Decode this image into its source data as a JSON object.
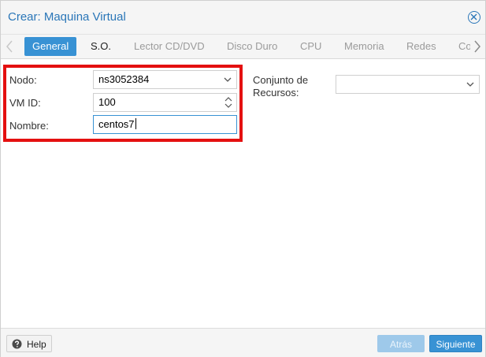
{
  "window": {
    "title": "Crear: Maquina Virtual"
  },
  "tabs": [
    {
      "label": "General",
      "state": "active"
    },
    {
      "label": "S.O.",
      "state": "enabled"
    },
    {
      "label": "Lector CD/DVD",
      "state": "disabled"
    },
    {
      "label": "Disco Duro",
      "state": "disabled"
    },
    {
      "label": "CPU",
      "state": "disabled"
    },
    {
      "label": "Memoria",
      "state": "disabled"
    },
    {
      "label": "Redes",
      "state": "disabled"
    },
    {
      "label": "Co",
      "state": "disabled"
    }
  ],
  "form": {
    "node_label": "Nodo:",
    "node_value": "ns3052384",
    "vmid_label": "VM ID:",
    "vmid_value": "100",
    "name_label": "Nombre:",
    "name_value": "centos7",
    "pool_label_line1": "Conjunto de",
    "pool_label_line2": "Recursos:",
    "pool_value": ""
  },
  "footer": {
    "help_label": "Help",
    "back_label": "Atrás",
    "next_label": "Siguiente"
  },
  "colors": {
    "accent": "#3892d4",
    "title": "#2a76b8",
    "highlight": "#e41010"
  },
  "icons": {
    "close": "close-circle-icon",
    "help": "question-circle-icon",
    "dropdown": "chevron-down-icon",
    "spinner": "spinner-arrows-icon",
    "scroll_left": "chevron-left-icon",
    "scroll_right": "chevron-right-icon"
  }
}
